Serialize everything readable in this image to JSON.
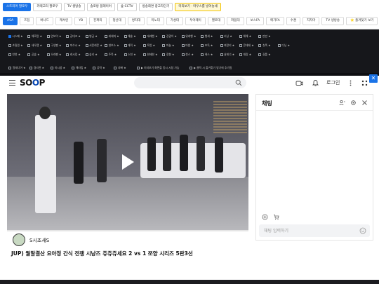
{
  "extension": {
    "row1": [
      {
        "label": "스트리머 팔로우",
        "style": "primary"
      },
      {
        "label": "카테고리 팔로우",
        "style": ""
      },
      {
        "label": "TV 생방송",
        "style": ""
      },
      {
        "label": "솔로방 플레이어",
        "style": ""
      },
      {
        "label": "숲 CCTV",
        "style": ""
      },
      {
        "label": "방송화면 광고차단기",
        "style": ""
      },
      {
        "label": "미리보기 · 마우스를 넣어놓세",
        "style": "hl"
      }
    ],
    "categories": [
      "ASA",
      "즈집",
      "버나드",
      "캐서린",
      "YB",
      "진짜리",
      "청산대",
      "쌍차대",
      "미노대",
      "가성대",
      "투어레이",
      "멜로대",
      "파붐대",
      "보스FA",
      "메가FA",
      "수겸",
      "지자마",
      "TV 생방송",
      "⭐ 즐겨찾기 보기"
    ],
    "active_category": "ASA"
  },
  "favorites": {
    "items": [
      "시스페 ★",
      "해로랑 ★",
      "연보이 ★",
      "공대조 ★",
      "병금 ★",
      "레헤머 ★",
      "해솔 ★",
      "데레헨 ★",
      "강광이 ★",
      "위레행 ★",
      "행쇄 ★",
      "리닝 ★",
      "해해 ★",
      "판딴 ★",
      "",
      "",
      "",
      "",
      "",
      "쵸밀원 ★",
      "새우팸 ★",
      "구생펜 ★",
      "따수시 ★",
      "서탄레몬 ★",
      "현보소 ★",
      "캐릭 ★",
      "토밤 ★",
      "마늘 ★",
      "마밭 ★",
      "포독 ★",
      "뵈망리 ★",
      "콘데레 ★",
      "츄폭 ★",
      "디닝 ★",
      "",
      "",
      "",
      "",
      "반천 ★",
      "공솔 ★",
      "오래펜 ★",
      "레시킹 ★",
      "숲리 ★",
      "주목 ★",
      "소천 ★",
      "현제한 ★",
      "정향 ★",
      "천스 ★",
      "헤스 ★",
      "살레너 ★",
      "재랑 ★",
      "길틀 ★",
      "",
      "",
      "",
      "",
      ""
    ],
    "checked_index": 0,
    "extra": [
      {
        "label": "알레너어 ★"
      },
      {
        "label": "경리천 ★"
      },
      {
        "label": "미시붐 ★"
      },
      {
        "label": "해라밈 ★"
      },
      {
        "label": "공력 ★"
      },
      {
        "label": "지빠 ★"
      },
      {
        "label": "▶ 미리보기 화면을 동시 시청 가능"
      },
      {
        "label": "▶ 클릭 시 즐겨찾기 방기에 추가됨"
      }
    ]
  },
  "header": {
    "logo": "SOOP",
    "search_placeholder": "",
    "login": "로그인"
  },
  "video": {
    "streamer": "S시조새S",
    "title": "JUP) 월말결산 요아정 간식 전쟁 시냥즈 쥬쥬쥬세요 2 vs 1 쪼양 시리즈 5판3선"
  },
  "chat": {
    "title": "채팅",
    "input_placeholder": "채팅 입력하기"
  }
}
